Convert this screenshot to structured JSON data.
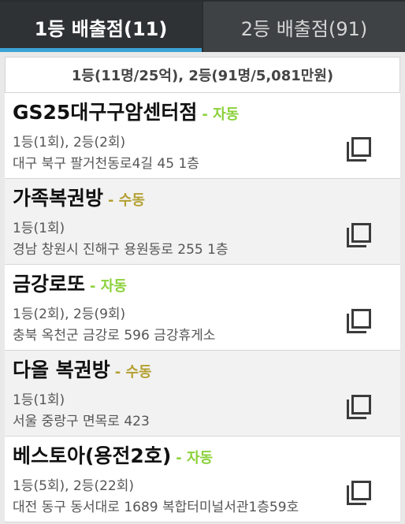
{
  "tabs": [
    {
      "label": "1등 배출점(11)",
      "active": true
    },
    {
      "label": "2등 배출점(91)",
      "active": false
    }
  ],
  "summary": "1등(11명/25억), 2등(91명/5,081만원)",
  "stores": [
    {
      "name": "GS25대구구암센터점",
      "method": "- 자동",
      "ranks": "1등(1회), 2등(2회)",
      "address": "대구 북구 팔거천동로4길 45 1층"
    },
    {
      "name": "가족복권방",
      "method": "- 수동",
      "ranks": "1등(1회)",
      "address": "경남 창원시 진해구 용원동로 255 1층"
    },
    {
      "name": "금강로또",
      "method": "- 자동",
      "ranks": "1등(2회), 2등(9회)",
      "address": "충북 옥천군 금강로 596 금강휴게소"
    },
    {
      "name": "다올 복권방",
      "method": "- 수동",
      "ranks": "1등(1회)",
      "address": "서울 중랑구 면목로 423"
    },
    {
      "name": "베스토아(용전2호)",
      "method": "- 자동",
      "ranks": "1등(5회), 2등(22회)",
      "address": "대전 동구 동서대로 1689 복합터미널서관1층59호"
    }
  ],
  "colors": {
    "tab_bar": "#3e4244",
    "tab_indicator": "#3aa3d6",
    "auto": "#8bd13a",
    "manual": "#b4a032"
  },
  "icons": {
    "copy": "copy-icon"
  }
}
